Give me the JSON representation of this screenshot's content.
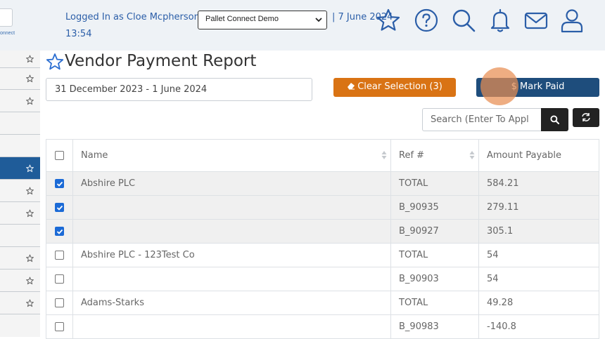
{
  "header": {
    "logo_fragment": "onnect",
    "login_text": "Logged In as Cloe Mcpherson |",
    "company_select": "Pallet Connect Demo",
    "date_text": "| 7 June 2024",
    "time_text": "13:54",
    "icons": [
      "star-icon",
      "help-icon",
      "search-icon",
      "bell-icon",
      "mail-icon",
      "user-icon"
    ]
  },
  "sidebar": {
    "active_color": "#1f5c99"
  },
  "page": {
    "title": "Vendor Payment Report",
    "date_range": "31 December 2023 - 1 June 2024",
    "clear_button": "Clear Selection (3)",
    "mark_paid_button": "$ Mark Paid",
    "search_placeholder": "Search (Enter To Appl"
  },
  "colors": {
    "clear_button": "#d97314",
    "mark_paid_button": "#1e4d7c",
    "accent_blue": "#2b5ea8"
  },
  "table": {
    "columns": [
      "Name",
      "Ref #",
      "Amount Payable"
    ],
    "rows": [
      {
        "checked": true,
        "name": "Abshire PLC",
        "ref": "TOTAL",
        "amount": "584.21"
      },
      {
        "checked": true,
        "name": "",
        "ref": "B_90935",
        "amount": "279.11"
      },
      {
        "checked": true,
        "name": "",
        "ref": "B_90927",
        "amount": "305.1"
      },
      {
        "checked": false,
        "name": "Abshire PLC - 123Test Co",
        "ref": "TOTAL",
        "amount": "54"
      },
      {
        "checked": false,
        "name": "",
        "ref": "B_90903",
        "amount": "54"
      },
      {
        "checked": false,
        "name": "Adams-Starks",
        "ref": "TOTAL",
        "amount": "49.28"
      },
      {
        "checked": false,
        "name": "",
        "ref": "B_90983",
        "amount": "-140.8"
      }
    ]
  }
}
